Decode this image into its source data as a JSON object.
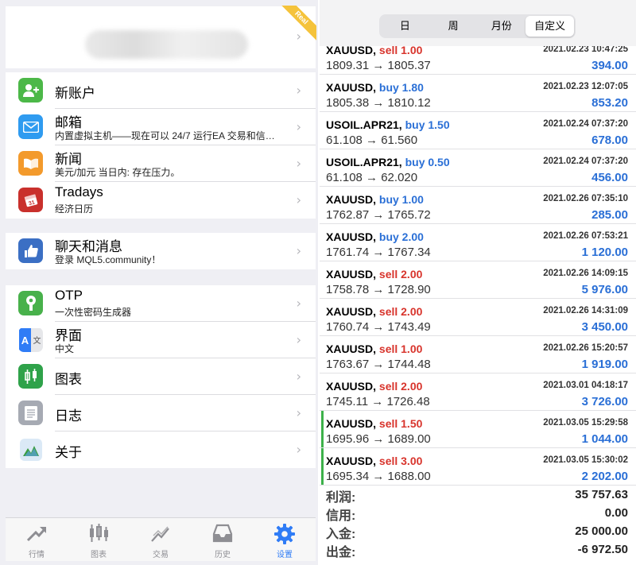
{
  "left": {
    "profile": {
      "badge": "Real"
    },
    "menu_group1": [
      {
        "title": "新账户",
        "subtitle": "",
        "icon": "add-account-icon",
        "color": "#4cb848"
      },
      {
        "title": "邮箱",
        "subtitle": "内置虚拟主机——现在可以 24/7 运行EA 交易和信…",
        "icon": "mail-icon",
        "color": "#2f9bf0"
      },
      {
        "title": "新闻",
        "subtitle": "美元/加元 当日内: 存在压力。",
        "icon": "news-book-icon",
        "color": "#f39a2c"
      },
      {
        "title": "Tradays",
        "subtitle": "经济日历",
        "icon": "tradays-calendar-icon",
        "color": "#c9302c"
      }
    ],
    "menu_group2": [
      {
        "title": "聊天和消息",
        "subtitle": "登录 MQL5.community！",
        "icon": "chat-thumbs-up-icon",
        "color": "#3b6fc4"
      }
    ],
    "menu_group3": [
      {
        "title": "OTP",
        "subtitle": "一次性密码生成器",
        "icon": "otp-key-icon",
        "color": "#48b14b"
      },
      {
        "title": "界面",
        "subtitle": "中文",
        "icon": "language-icon",
        "color": "#2f7cf6"
      },
      {
        "title": "图表",
        "subtitle": "",
        "icon": "chart-candles-icon",
        "color": "#2fa24a"
      },
      {
        "title": "日志",
        "subtitle": "",
        "icon": "journal-icon",
        "color": "#a6aab3"
      },
      {
        "title": "关于",
        "subtitle": "",
        "icon": "about-metatrader-icon",
        "color": "#5aa0d8"
      }
    ],
    "tabs": [
      {
        "label": "行情",
        "icon": "quotes-arrow-icon",
        "active": false
      },
      {
        "label": "图表",
        "icon": "chart-candles-icon",
        "active": false
      },
      {
        "label": "交易",
        "icon": "trade-trend-icon",
        "active": false
      },
      {
        "label": "历史",
        "icon": "history-inbox-icon",
        "active": false
      },
      {
        "label": "设置",
        "icon": "settings-gear-icon",
        "active": true
      }
    ],
    "active_color": "#2f7cf6"
  },
  "right": {
    "periods": [
      {
        "label": "日",
        "selected": false
      },
      {
        "label": "周",
        "selected": false
      },
      {
        "label": "月份",
        "selected": false
      },
      {
        "label": "自定义",
        "selected": true
      }
    ],
    "trades": [
      {
        "symbol": "XAUUSD,",
        "side": "sell",
        "volume": "sell 1.00",
        "datetime": "2021.02.23 10:47:25",
        "prices": "1809.31 → 1805.37",
        "profit": "394.00",
        "marked": false
      },
      {
        "symbol": "XAUUSD,",
        "side": "buy",
        "volume": "buy 1.80",
        "datetime": "2021.02.23 12:07:05",
        "prices": "1805.38 → 1810.12",
        "profit": "853.20",
        "marked": false
      },
      {
        "symbol": "USOIL.APR21,",
        "side": "buy",
        "volume": "buy 1.50",
        "datetime": "2021.02.24 07:37:20",
        "prices": "61.108 → 61.560",
        "profit": "678.00",
        "marked": false
      },
      {
        "symbol": "USOIL.APR21,",
        "side": "buy",
        "volume": "buy 0.50",
        "datetime": "2021.02.24 07:37:20",
        "prices": "61.108 → 62.020",
        "profit": "456.00",
        "marked": false
      },
      {
        "symbol": "XAUUSD,",
        "side": "buy",
        "volume": "buy 1.00",
        "datetime": "2021.02.26 07:35:10",
        "prices": "1762.87 → 1765.72",
        "profit": "285.00",
        "marked": false
      },
      {
        "symbol": "XAUUSD,",
        "side": "buy",
        "volume": "buy 2.00",
        "datetime": "2021.02.26 07:53:21",
        "prices": "1761.74 → 1767.34",
        "profit": "1 120.00",
        "marked": false
      },
      {
        "symbol": "XAUUSD,",
        "side": "sell",
        "volume": "sell 2.00",
        "datetime": "2021.02.26 14:09:15",
        "prices": "1758.78 → 1728.90",
        "profit": "5 976.00",
        "marked": false
      },
      {
        "symbol": "XAUUSD,",
        "side": "sell",
        "volume": "sell 2.00",
        "datetime": "2021.02.26 14:31:09",
        "prices": "1760.74 → 1743.49",
        "profit": "3 450.00",
        "marked": false
      },
      {
        "symbol": "XAUUSD,",
        "side": "sell",
        "volume": "sell 1.00",
        "datetime": "2021.02.26 15:20:57",
        "prices": "1763.67 → 1744.48",
        "profit": "1 919.00",
        "marked": false
      },
      {
        "symbol": "XAUUSD,",
        "side": "sell",
        "volume": "sell 2.00",
        "datetime": "2021.03.01 04:18:17",
        "prices": "1745.11 → 1726.48",
        "profit": "3 726.00",
        "marked": false
      },
      {
        "symbol": "XAUUSD,",
        "side": "sell",
        "volume": "sell 1.50",
        "datetime": "2021.03.05 15:29:58",
        "prices": "1695.96 → 1689.00",
        "profit": "1 044.00",
        "marked": true
      },
      {
        "symbol": "XAUUSD,",
        "side": "sell",
        "volume": "sell 3.00",
        "datetime": "2021.03.05 15:30:02",
        "prices": "1695.34 → 1688.00",
        "profit": "2 202.00",
        "marked": true
      }
    ],
    "summary": [
      {
        "label": "利润:",
        "value": "35 757.63"
      },
      {
        "label": "信用:",
        "value": "0.00"
      },
      {
        "label": "入金:",
        "value": "25 000.00"
      },
      {
        "label": "出金:",
        "value": "-6 972.50"
      }
    ],
    "colors": {
      "buy": "#2a6fd6",
      "sell": "#d8342c",
      "profit": "#2a6fd6",
      "marker": "#3db14a"
    }
  }
}
